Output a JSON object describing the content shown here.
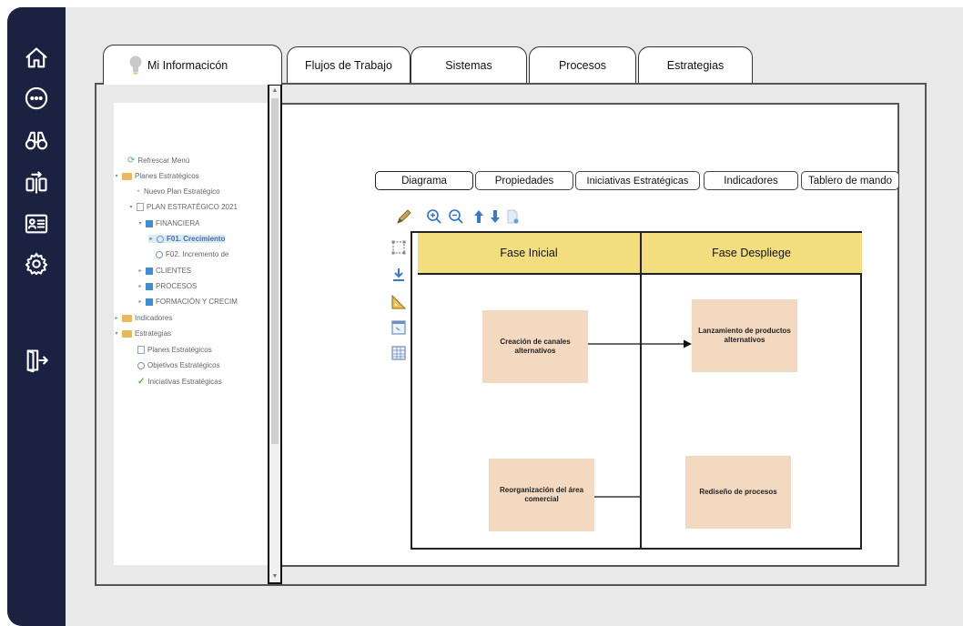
{
  "tabs": [
    {
      "id": "mi-informacion",
      "label": "Mi Informacicón"
    },
    {
      "id": "flujos",
      "label": "Flujos de Trabajo"
    },
    {
      "id": "sistemas",
      "label": "Sistemas"
    },
    {
      "id": "procesos",
      "label": "Procesos"
    },
    {
      "id": "estrategias",
      "label": "Estrategias"
    }
  ],
  "sidebar_icons": [
    "home-icon",
    "more-icon",
    "binoculars-icon",
    "sync-icon",
    "id-card-icon",
    "gear-icon",
    "exit-icon"
  ],
  "tree": {
    "items": [
      {
        "label": "Refrescar Menú",
        "icon": "refresh-icon"
      },
      {
        "label": "Planes Estratégicos",
        "icon": "folder-icon"
      },
      {
        "label": "Nuevo Plan Estratégico",
        "icon": "bullet-icon"
      },
      {
        "label": "PLAN ESTRATÉGICO 2021",
        "icon": "plan-icon"
      },
      {
        "label": "FINANCIERA",
        "icon": "cube-icon"
      },
      {
        "label": "F01. Crecimiento",
        "icon": "circle-icon"
      },
      {
        "label": "F02. Incremento de",
        "icon": "circle-icon"
      },
      {
        "label": "CLIENTES",
        "icon": "cube-icon"
      },
      {
        "label": "PROCESOS",
        "icon": "cube-icon"
      },
      {
        "label": "FORMACIÓN Y CRECIM",
        "icon": "cube-icon"
      },
      {
        "label": "Indicadores",
        "icon": "folder-icon"
      },
      {
        "label": "Estrategias",
        "icon": "folder-icon"
      },
      {
        "label": "Planes Estratégicos",
        "icon": "plan-icon"
      },
      {
        "label": "Objetivos Estratégicos",
        "icon": "circle-icon"
      },
      {
        "label": "Iniciativas Estratégicas",
        "icon": "check-icon"
      }
    ]
  },
  "subtabs": [
    {
      "label": "Diagrama"
    },
    {
      "label": "Propiedades"
    },
    {
      "label": "Iniciativas Estratégicas"
    },
    {
      "label": "Indicadores"
    },
    {
      "label": "Tablero de mando"
    }
  ],
  "toolbar_icons": [
    "pencil-icon",
    "zoom-in-icon",
    "zoom-out-icon",
    "move-up-icon",
    "move-down-icon",
    "page-icon"
  ],
  "palette_icons": [
    "select-area-icon",
    "download-icon",
    "ruler-icon",
    "window-icon",
    "table-icon"
  ],
  "diagram": {
    "phases": [
      {
        "label": "Fase Inicial"
      },
      {
        "label": "Fase Despliege"
      }
    ],
    "nodes": [
      {
        "label": "Creación de canales alternativos"
      },
      {
        "label": "Lanzamiento de productos alternativos"
      },
      {
        "label": "Reorganización del área comercial"
      },
      {
        "label": "Rediseño de procesos"
      }
    ]
  },
  "colors": {
    "sidebar_bg": "#1b2140",
    "phase_header": "#f3de7f",
    "node_fill": "#f2d9bf",
    "background": "#e9e9e9"
  }
}
